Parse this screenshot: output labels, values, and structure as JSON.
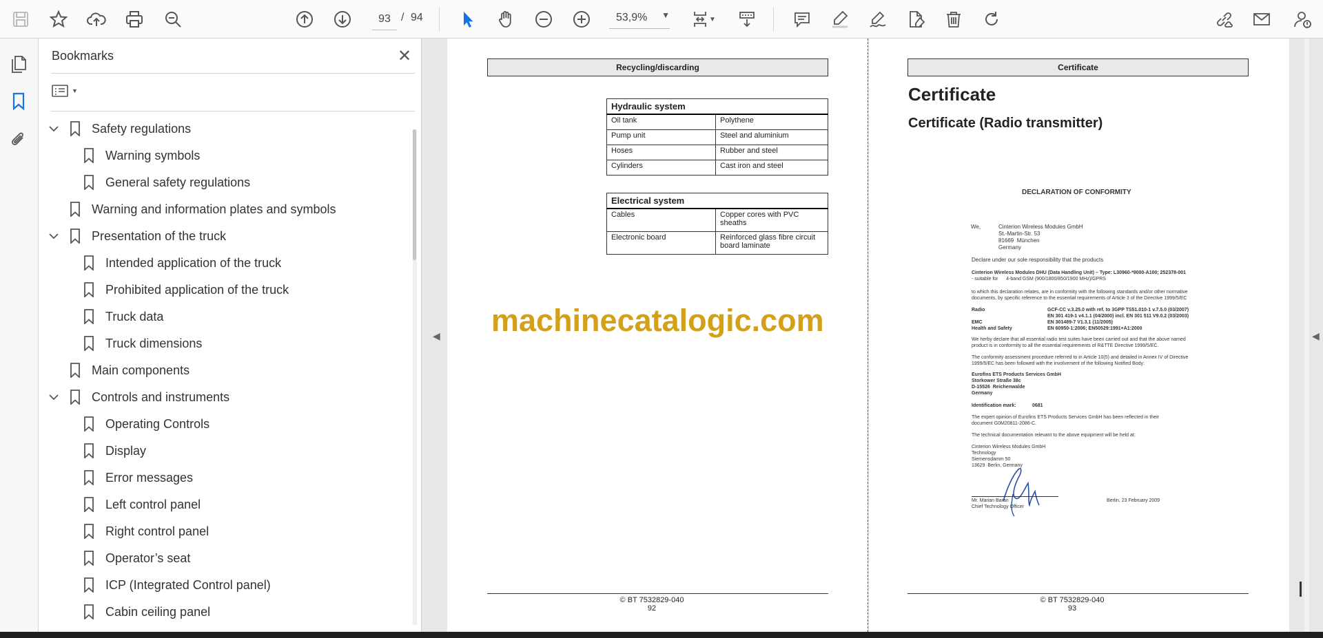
{
  "toolbar": {
    "current_page": "93",
    "page_separator": "/",
    "total_pages": "94",
    "zoom": "53,9%"
  },
  "bookmarks": {
    "title": "Bookmarks",
    "items": [
      {
        "label": "Safety regulations",
        "level": 0,
        "expandable": true
      },
      {
        "label": "Warning symbols",
        "level": 1,
        "expandable": false
      },
      {
        "label": "General safety regulations",
        "level": 1,
        "expandable": false
      },
      {
        "label": "Warning and information plates and symbols",
        "level": 0,
        "expandable": false
      },
      {
        "label": "Presentation of the truck",
        "level": 0,
        "expandable": true
      },
      {
        "label": "Intended application of the truck",
        "level": 1,
        "expandable": false
      },
      {
        "label": "Prohibited application of the truck",
        "level": 1,
        "expandable": false
      },
      {
        "label": "Truck data",
        "level": 1,
        "expandable": false
      },
      {
        "label": "Truck dimensions",
        "level": 1,
        "expandable": false
      },
      {
        "label": "Main components",
        "level": 0,
        "expandable": false
      },
      {
        "label": "Controls and instruments",
        "level": 0,
        "expandable": true
      },
      {
        "label": "Operating Controls",
        "level": 1,
        "expandable": false
      },
      {
        "label": "Display",
        "level": 1,
        "expandable": false
      },
      {
        "label": "Error messages",
        "level": 1,
        "expandable": false
      },
      {
        "label": "Left control panel",
        "level": 1,
        "expandable": false
      },
      {
        "label": "Right control panel",
        "level": 1,
        "expandable": false
      },
      {
        "label": "Operator’s seat",
        "level": 1,
        "expandable": false
      },
      {
        "label": "ICP (Integrated Control panel)",
        "level": 1,
        "expandable": false
      },
      {
        "label": "Cabin ceiling panel",
        "level": 1,
        "expandable": false
      }
    ]
  },
  "page_left": {
    "header": "Recycling/discarding",
    "hydraulic": {
      "title": "Hydraulic system",
      "rows": [
        [
          "Oil tank",
          "Polythene"
        ],
        [
          "Pump unit",
          "Steel and aluminium"
        ],
        [
          "Hoses",
          "Rubber and steel"
        ],
        [
          "Cylinders",
          "Cast iron and steel"
        ]
      ]
    },
    "electrical": {
      "title": "Electrical system",
      "rows": [
        [
          "Cables",
          "Copper cores with PVC sheaths"
        ],
        [
          "Electronic board",
          "Reinforced glass fibre circuit board laminate"
        ]
      ]
    },
    "watermark": "machinecatalogic.com",
    "footer_doc": "© BT 7532829-040",
    "footer_page": "92"
  },
  "page_right": {
    "header": "Certificate",
    "title": "Certificate",
    "subtitle": "Certificate (Radio transmitter)",
    "declaration_title": "DECLARATION OF CONFORMITY",
    "we_label": "We,",
    "address": [
      "Cinterion Wireless Modules GmbH",
      "St.-Martin-Str. 53",
      "81669  München",
      "Germany"
    ],
    "declare": "Declare under our sole responsibility that the products",
    "product_line1": "Cinterion Wireless Modules DHU (Data Handling Unit) – Type: L30960-*9000-A100; 252378-001",
    "product_line2": "- suitable for      4-band GSM (900/1800/850/1900 MHz)/GPRS",
    "conformity_line1": "to which this declaration relates, are in conformity with the following standards and/or other normative",
    "conformity_line2": "documents, by specific reference to the essential requirements of Article 3 of the Directive 1999/5/EC",
    "standards": [
      {
        "label": "Radio",
        "value": "GCF-CC v.3.25.0 with ref. to 3GPP TS51.010-1 v.7.5.0 (03/2007)"
      },
      {
        "label": "",
        "value": "EN 301 419-1 v4.1.1 (04/2000) incl. EN 301 511 V9.0.2 (03/2003)"
      },
      {
        "label": "EMC",
        "value": "EN 301489-7 V1.3.1 (11/2005)"
      },
      {
        "label": "Health and Safety",
        "value": "EN 60950-1:2006; EN50529:1991+A1:2000"
      }
    ],
    "radio_para1": "We herby declare that all essential radio test suites have been carried out and that the above named",
    "radio_para2": "product is in conformity to all the essential requirements of R&TTE Directive 1999/5/EC.",
    "procedure_para1": "The conformity assessment procedure referred to in Article 10(5) and detailed in Annex IV of Directive",
    "procedure_para2": "1999/5/EC has been followed with the involvement of the following Notified Body:",
    "notified_body": [
      "Eurofins ETS Products Services GmbH",
      "Storkower Straße 38c",
      "D-15526  Reichenwalde",
      "Germany"
    ],
    "id_mark_label": "Identification mark:",
    "id_mark_value": "0681",
    "opinion_line1": "The expert opinion of Eurofins ETS Products Services GmbH has been reflected in their",
    "opinion_line2": "document G0M20811-2086-C.",
    "techdoc": "The technical documentation relevant to the above equipment will be held at:",
    "tech_address": [
      "Cinterion Wireless Modules GmbH",
      "Technology",
      "Siemensdamm 50",
      "13629  Berlin, Germany"
    ],
    "signer_name": "Mr. Marian Baran",
    "signer_title": "Chief Technology Officer",
    "place_date": "Berlin, 23 February 2009",
    "footer_doc": "© BT 7532829-040",
    "footer_page": "93"
  }
}
